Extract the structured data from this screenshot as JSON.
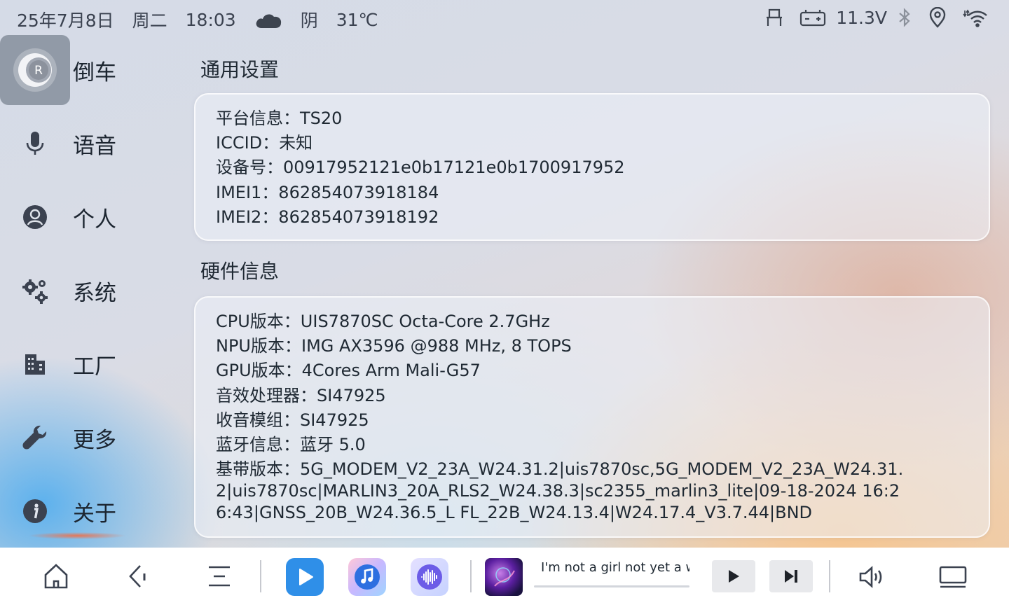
{
  "status_bar": {
    "date": "25年7月8日",
    "weekday": "周二",
    "time": "18:03",
    "weather_icon": "cloud-icon",
    "weather": "阴",
    "temperature": "31℃",
    "voltage": "11.3V"
  },
  "sidebar": {
    "items": [
      {
        "label": "倒车",
        "icon": "reverse-icon",
        "active": true
      },
      {
        "label": "语音",
        "icon": "microphone-icon"
      },
      {
        "label": "个人",
        "icon": "user-icon"
      },
      {
        "label": "系统",
        "icon": "gears-icon"
      },
      {
        "label": "工厂",
        "icon": "factory-icon"
      },
      {
        "label": "更多",
        "icon": "wrench-icon"
      },
      {
        "label": "关于",
        "icon": "info-icon"
      }
    ]
  },
  "general": {
    "title": "通用设置",
    "rows": [
      "平台信息：TS20",
      "ICCID：未知",
      "设备号：00917952121e0b17121e0b1700917952",
      "IMEI1：862854073918184",
      "IMEI2：862854073918192"
    ]
  },
  "hardware": {
    "title": "硬件信息",
    "rows": [
      "CPU版本：UIS7870SC Octa-Core 2.7GHz",
      "NPU版本：IMG AX3596 @988 MHz, 8 TOPS",
      "GPU版本：4Cores Arm Mali-G57",
      "音效处理器：SI47925",
      "收音模组：SI47925",
      "蓝牙信息：蓝牙 5.0"
    ],
    "baseband": "基带版本：5G_MODEM_V2_23A_W24.31.2|uis7870sc,5G_MODEM_V2_23A_W24.31.2|uis7870sc|MARLIN3_20A_RLS2_W24.38.3|sc2355_marlin3_lite|09-18-2024 16:26:43|GNSS_20B_W24.36.5_L FL_22B_W24.13.4|W24.17.4_V3.7.44|BND"
  },
  "dock": {
    "now_playing": "I'm not a girl not yet a woman",
    "progress": 0.0
  },
  "colors": {
    "accent_blue": "#2f8fe8",
    "active_item_bg": "#6b7380"
  }
}
